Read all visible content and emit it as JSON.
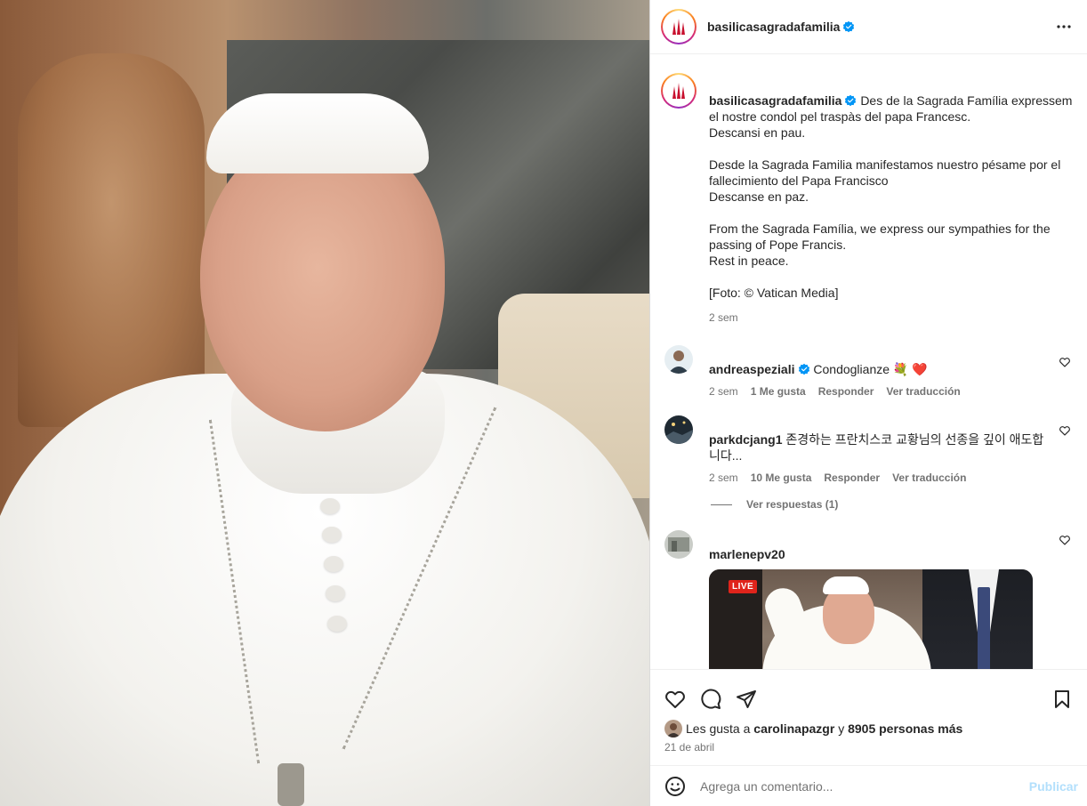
{
  "post": {
    "author": "basilicasagradafamilia",
    "verified": true,
    "caption": "Des de la Sagrada Família expressem el nostre condol pel traspàs del papa Francesc.\nDescansi en pau.\n\nDesde la Sagrada Familia manifestamos nuestro pésame por el fallecimiento del Papa Francisco\nDescanse en paz.\n\nFrom the Sagrada Família, we express our sympathies for the passing of Pope Francis.\nRest in peace.\n\n[Foto: © Vatican Media]",
    "caption_age": "2 sem",
    "likes_prefix": "Les gusta a",
    "likes_user": "carolinapazgr",
    "likes_join": "y",
    "likes_rest": "8905 personas más",
    "date": "21 de abril"
  },
  "comments": [
    {
      "user": "andreaspeziali",
      "verified": true,
      "text": "Condoglianze 💐 ❤️",
      "age": "2 sem",
      "likes": "1 Me gusta",
      "reply": "Responder",
      "translate": "Ver traducción"
    },
    {
      "user": "parkdcjang1",
      "verified": false,
      "text": "존경하는 프란치스코 교황님의 선종을 깊이 애도합니다...",
      "age": "2 sem",
      "likes": "10 Me gusta",
      "reply": "Responder",
      "translate": "Ver traducción",
      "view_replies": "Ver respuestas (1)"
    },
    {
      "user": "marlenepv20",
      "verified": false,
      "gif_badge": "LIVE"
    }
  ],
  "composer": {
    "placeholder": "Agrega un comentario...",
    "publish": "Publicar"
  },
  "icons": {
    "more": "more-horizontal-icon",
    "like": "heart-icon",
    "comment": "comment-icon",
    "share": "send-icon",
    "save": "bookmark-icon",
    "emoji": "emoji-icon",
    "verified": "verified-badge-icon"
  },
  "colors": {
    "verified": "#0095f6",
    "heart_red": "#ff3040",
    "muted": "#737373",
    "publish_disabled": "#b2dffc"
  }
}
